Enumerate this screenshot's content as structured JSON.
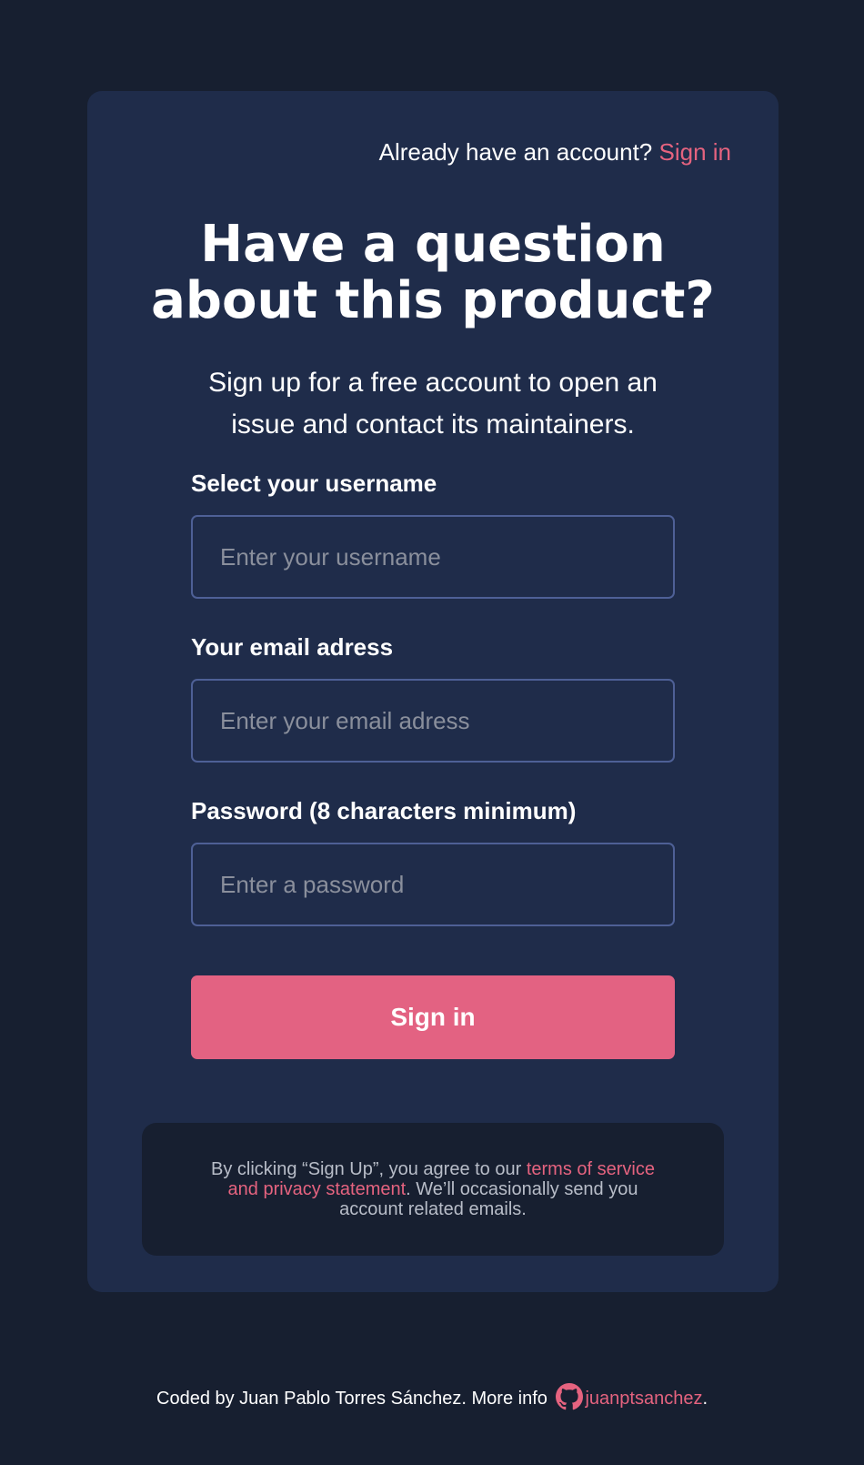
{
  "header": {
    "prompt": "Already have an account?",
    "signin_link": "Sign in"
  },
  "intro": {
    "title": "Have a question about this product?",
    "subtitle": "Sign up for a free account to open an issue and contact its maintainers."
  },
  "form": {
    "username": {
      "label": "Select your username",
      "placeholder": "Enter your username",
      "value": ""
    },
    "email": {
      "label": "Your email adress",
      "placeholder": "Enter your email adress",
      "value": ""
    },
    "password": {
      "label": "Password (8 characters minimum)",
      "placeholder": "Enter a password",
      "value": ""
    },
    "submit_label": "Sign in"
  },
  "legal": {
    "before": "By clicking “Sign Up”, you agree to our ",
    "link": "terms of service and privacy statement",
    "after": ". We’ll occasionally send you account related emails."
  },
  "footer": {
    "text": "Coded by Juan Pablo Torres Sánchez. More info",
    "icon": "github-icon",
    "link": "juanptsanchez",
    "end": "."
  },
  "colors": {
    "page_bg": "#171f30",
    "card_bg": "#1f2c4a",
    "accent": "#e36282",
    "input_border": "#4e6096"
  }
}
